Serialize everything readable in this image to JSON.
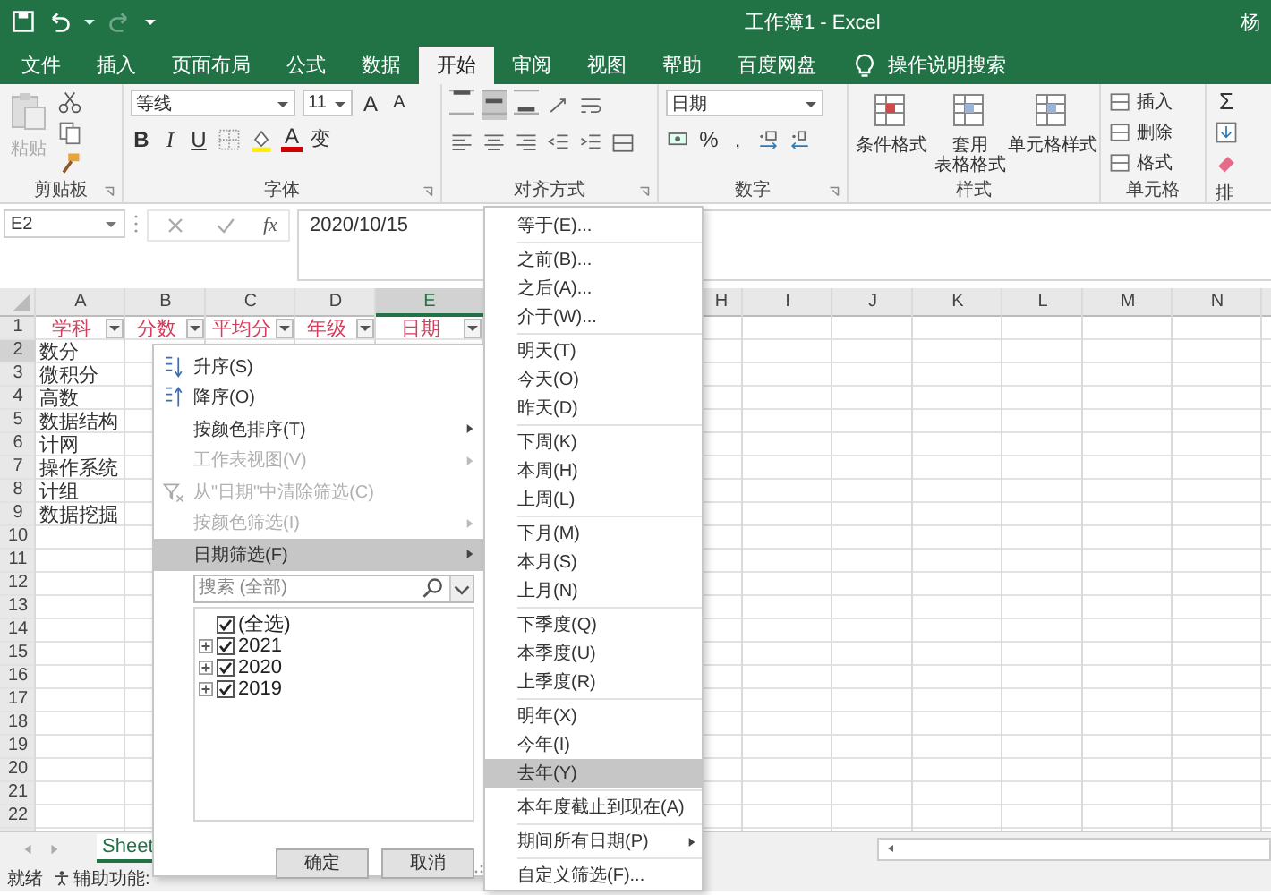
{
  "title_bar": {
    "title": "工作簿1  -  Excel",
    "user": "杨"
  },
  "ribbon_tabs": [
    {
      "label": "文件",
      "selected": false
    },
    {
      "label": "插入",
      "selected": false
    },
    {
      "label": "页面布局",
      "selected": false
    },
    {
      "label": "公式",
      "selected": false
    },
    {
      "label": "数据",
      "selected": false
    },
    {
      "label": "开始",
      "selected": true
    },
    {
      "label": "审阅",
      "selected": false
    },
    {
      "label": "视图",
      "selected": false
    },
    {
      "label": "帮助",
      "selected": false
    },
    {
      "label": "百度网盘",
      "selected": false
    }
  ],
  "tell_me": "操作说明搜索",
  "ribbon_groups": [
    {
      "kind": "clipboard",
      "label": "剪贴板",
      "paste": "粘贴",
      "paste_disabled": true
    },
    {
      "kind": "font",
      "label": "字体",
      "font_name": "等线",
      "font_size": "11",
      "grow": "A",
      "shrink": "A",
      "bold": "B",
      "italic": "I",
      "underline": "U",
      "font_color": "A",
      "phonetic": "变"
    },
    {
      "kind": "alignment",
      "label": "对齐方式",
      "vertical_align": [
        {
          "selected": false
        },
        {
          "selected": true
        },
        {
          "selected": false
        }
      ]
    },
    {
      "kind": "number",
      "label": "数字",
      "format": "日期",
      "percent": "%",
      "comma": ","
    },
    {
      "kind": "styles",
      "label": "样式",
      "buttons": [
        {
          "lines": [
            "条件格式"
          ]
        },
        {
          "lines": [
            "套用",
            "表格格式"
          ]
        },
        {
          "lines": [
            "单元格样式"
          ]
        }
      ]
    },
    {
      "kind": "cells",
      "label": "单元格",
      "buttons": [
        "插入",
        "删除",
        "格式"
      ]
    },
    {
      "kind": "editing",
      "sum": "Σ",
      "sort": "排"
    }
  ],
  "formula_bar": {
    "name_box": "E2",
    "fx": "fx",
    "value": "2020/10/15"
  },
  "sheet": {
    "columns": [
      {
        "label": "A",
        "selected": false
      },
      {
        "label": "B",
        "selected": false
      },
      {
        "label": "C",
        "selected": false
      },
      {
        "label": "D",
        "selected": false
      },
      {
        "label": "E",
        "selected": true
      },
      {
        "label": "H",
        "selected": false
      },
      {
        "label": "I",
        "selected": false
      },
      {
        "label": "J",
        "selected": false
      },
      {
        "label": "K",
        "selected": false
      },
      {
        "label": "L",
        "selected": false
      },
      {
        "label": "M",
        "selected": false
      },
      {
        "label": "N",
        "selected": false
      }
    ],
    "row_numbers": [
      "1",
      "2",
      "3",
      "4",
      "5",
      "6",
      "7",
      "8",
      "9",
      "10",
      "11",
      "12",
      "13",
      "14",
      "15",
      "16",
      "17",
      "18",
      "19",
      "20",
      "21",
      "22"
    ],
    "header_row": [
      "学科",
      "分数",
      "平均分",
      "年级",
      "日期"
    ],
    "column_a": [
      "数分",
      "微积分",
      "高数",
      "数据结构",
      "计网",
      "操作系统",
      "计组",
      "数据挖掘"
    ]
  },
  "sheet_tabs": [
    {
      "label": "Sheet"
    }
  ],
  "status_bar": {
    "ready": "就绪",
    "accessibility": "辅助功能:"
  },
  "filter_menu": {
    "items": [
      {
        "kind": "sort_asc",
        "label": "升序(S)",
        "disabled": false,
        "submenu": false,
        "selected": false
      },
      {
        "kind": "sort_desc",
        "label": "降序(O)",
        "disabled": false,
        "submenu": false,
        "selected": false
      },
      {
        "kind": "plain",
        "label": "按颜色排序(T)",
        "disabled": false,
        "submenu": true,
        "selected": false
      },
      {
        "kind": "plain",
        "label": "工作表视图(V)",
        "disabled": true,
        "submenu": true,
        "selected": false
      },
      {
        "kind": "clear_filter",
        "label": "从\"日期\"中清除筛选(C)",
        "disabled": true,
        "submenu": false,
        "selected": false
      },
      {
        "kind": "plain",
        "label": "按颜色筛选(I)",
        "disabled": true,
        "submenu": true,
        "selected": false
      },
      {
        "kind": "plain",
        "label": "日期筛选(F)",
        "disabled": false,
        "submenu": true,
        "selected": true
      }
    ],
    "search": {
      "placeholder": "搜索 (全部)"
    },
    "tree": [
      {
        "kind": "all",
        "label": "(全选)",
        "checked": true
      },
      {
        "kind": "year",
        "label": "2021",
        "checked": true,
        "expanded": false
      },
      {
        "kind": "year",
        "label": "2020",
        "checked": true,
        "expanded": false
      },
      {
        "kind": "year",
        "label": "2019",
        "checked": true,
        "expanded": false
      }
    ],
    "buttons": [
      "确定",
      "取消"
    ]
  },
  "date_submenu": {
    "groups": [
      [
        {
          "label": "等于(E)...",
          "selected": false,
          "submenu": false
        }
      ],
      [
        {
          "label": "之前(B)...",
          "selected": false,
          "submenu": false
        },
        {
          "label": "之后(A)...",
          "selected": false,
          "submenu": false
        },
        {
          "label": "介于(W)...",
          "selected": false,
          "submenu": false
        }
      ],
      [
        {
          "label": "明天(T)",
          "selected": false,
          "submenu": false
        },
        {
          "label": "今天(O)",
          "selected": false,
          "submenu": false
        },
        {
          "label": "昨天(D)",
          "selected": false,
          "submenu": false
        }
      ],
      [
        {
          "label": "下周(K)",
          "selected": false,
          "submenu": false
        },
        {
          "label": "本周(H)",
          "selected": false,
          "submenu": false
        },
        {
          "label": "上周(L)",
          "selected": false,
          "submenu": false
        }
      ],
      [
        {
          "label": "下月(M)",
          "selected": false,
          "submenu": false
        },
        {
          "label": "本月(S)",
          "selected": false,
          "submenu": false
        },
        {
          "label": "上月(N)",
          "selected": false,
          "submenu": false
        }
      ],
      [
        {
          "label": "下季度(Q)",
          "selected": false,
          "submenu": false
        },
        {
          "label": "本季度(U)",
          "selected": false,
          "submenu": false
        },
        {
          "label": "上季度(R)",
          "selected": false,
          "submenu": false
        }
      ],
      [
        {
          "label": "明年(X)",
          "selected": false,
          "submenu": false
        },
        {
          "label": "今年(I)",
          "selected": false,
          "submenu": false
        },
        {
          "label": "去年(Y)",
          "selected": true,
          "submenu": false
        }
      ],
      [
        {
          "label": "本年度截止到现在(A)",
          "selected": false,
          "submenu": false
        }
      ],
      [
        {
          "label": "期间所有日期(P)",
          "selected": false,
          "submenu": true
        }
      ],
      [
        {
          "label": "自定义筛选(F)...",
          "selected": false,
          "submenu": false
        }
      ]
    ]
  }
}
